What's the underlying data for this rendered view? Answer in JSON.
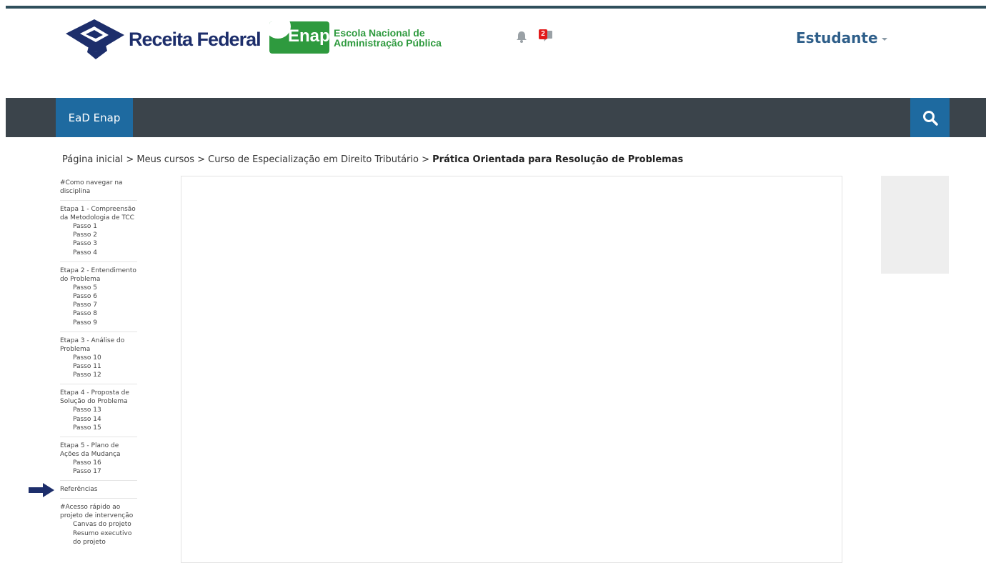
{
  "header": {
    "logo_receita_text": "Receita Federal",
    "logo_enap_word": "Enap",
    "logo_enap_line1": "Escola Nacional de",
    "logo_enap_line2": "Administração Pública",
    "notifications_icon": "bell-icon",
    "messages_icon": "message-icon",
    "messages_count": "2",
    "user_label": "Estudante"
  },
  "navbar": {
    "brand": "EaD Enap",
    "search_icon": "search-icon"
  },
  "breadcrumb": {
    "items": [
      "Página inicial",
      "Meus cursos",
      "Curso de Especialização em Direito Tributário"
    ],
    "separator": " > ",
    "current": "Prática Orientada para Resolução de Problemas"
  },
  "sidebar": {
    "groups": [
      {
        "title": "#Como navegar na disciplina",
        "items": []
      },
      {
        "title": "Etapa 1 - Compreensão da Metodologia de TCC",
        "items": [
          "Passo 1",
          "Passo 2",
          "Passo 3",
          "Passo 4"
        ]
      },
      {
        "title": "Etapa 2 - Entendimento do Problema",
        "items": [
          "Passo 5",
          "Passo 6",
          "Passo 7",
          "Passo 8",
          "Passo 9"
        ]
      },
      {
        "title": "Etapa 3 - Análise do Problema",
        "items": [
          "Passo 10",
          "Passo 11",
          "Passo 12"
        ]
      },
      {
        "title": "Etapa 4 - Proposta de Solução do Problema",
        "items": [
          "Passo 13",
          "Passo 14",
          "Passo 15"
        ]
      },
      {
        "title": "Etapa 5 - Plano de Ações da Mudança",
        "items": [
          "Passo 16",
          "Passo 17"
        ]
      },
      {
        "title": "Referências",
        "items": []
      },
      {
        "title": "#Acesso rápido ao projeto de intervenção",
        "items": [
          "Canvas do projeto",
          "Resumo executivo do projeto"
        ]
      }
    ]
  },
  "colors": {
    "navbar_bg": "#3b444b",
    "accent_blue": "#1e6aa0",
    "enap_green": "#2e9a3e",
    "badge_red": "#e21b1b",
    "arrow_navy": "#1d2e6b"
  }
}
